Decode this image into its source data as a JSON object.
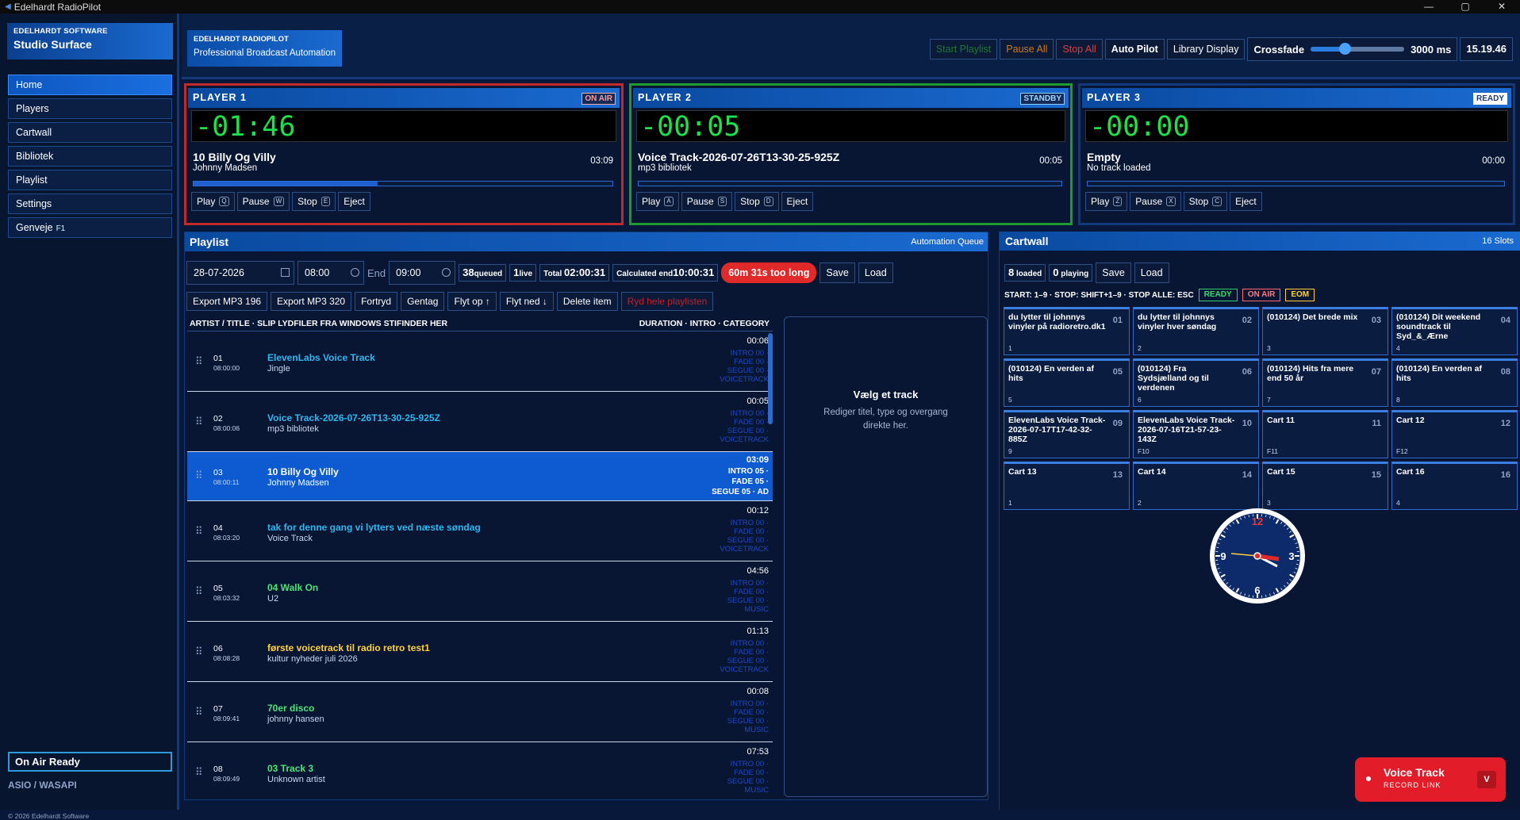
{
  "window": {
    "title": "Edelhardt RadioPilot",
    "controls": [
      "—",
      "▢",
      "✕"
    ]
  },
  "sidebar": {
    "brand_line1": "EDELHARDT SOFTWARE",
    "brand_line2": "Studio Surface",
    "items": [
      {
        "label": "Home",
        "active": true
      },
      {
        "label": "Players"
      },
      {
        "label": "Cartwall"
      },
      {
        "label": "Bibliotek"
      },
      {
        "label": "Playlist"
      },
      {
        "label": "Settings"
      },
      {
        "label": "Genveje",
        "key": "F1"
      }
    ],
    "on_air_ready": "On Air Ready",
    "audio_api": "ASIO / WASAPI",
    "copyright": "© 2026 Edelhardt Software"
  },
  "topbar": {
    "brand_line1": "EDELHARDT RADIOPILOT",
    "brand_line2": "Professional Broadcast Automation",
    "start_playlist": "Start Playlist",
    "pause_all": "Pause All",
    "stop_all": "Stop All",
    "auto_pilot": "Auto Pilot",
    "library_display": "Library Display",
    "crossfade_label": "Crossfade",
    "crossfade_value": "3000 ms",
    "crossfade_level": 0.36,
    "clock": "15.19.46"
  },
  "players": [
    {
      "name": "PLAYER 1",
      "status": "ON AIR",
      "timer": "-01:46",
      "title": "10 Billy Og Villy",
      "artist": "Johnny Madsen",
      "duration": "03:09",
      "progress": 0.44,
      "buttons": [
        {
          "label": "Play",
          "key": "Q"
        },
        {
          "label": "Pause",
          "key": "W"
        },
        {
          "label": "Stop",
          "key": "E"
        },
        {
          "label": "Eject"
        }
      ]
    },
    {
      "name": "PLAYER 2",
      "status": "STANDBY",
      "timer": "-00:05",
      "title": "Voice Track-2026-07-26T13-30-25-925Z",
      "artist": "mp3 bibliotek",
      "duration": "00:05",
      "progress": 0,
      "buttons": [
        {
          "label": "Play",
          "key": "A"
        },
        {
          "label": "Pause",
          "key": "S"
        },
        {
          "label": "Stop",
          "key": "D"
        },
        {
          "label": "Eject"
        }
      ]
    },
    {
      "name": "PLAYER 3",
      "status": "READY",
      "timer": "-00:00",
      "title": "Empty",
      "artist": "No track loaded",
      "duration": "00:00",
      "progress": 0,
      "buttons": [
        {
          "label": "Play",
          "key": "Z"
        },
        {
          "label": "Pause",
          "key": "X"
        },
        {
          "label": "Stop",
          "key": "C"
        },
        {
          "label": "Eject"
        }
      ]
    }
  ],
  "playlist": {
    "title": "Playlist",
    "subtitle": "Automation Queue",
    "date": "28-07-2026",
    "start_time": "08:00",
    "end_label": "End",
    "end_time": "09:00",
    "queued_num": "38",
    "queued_label": "queued",
    "live_num": "1",
    "live_label": "live",
    "total_label": "Total",
    "total_value": "02:00:31",
    "calc_label": "Calculated end",
    "calc_value": "10:00:31",
    "too_long": "60m 31s too long",
    "save": "Save",
    "load": "Load",
    "tools": [
      "Export MP3 196",
      "Export MP3 320",
      "Fortryd",
      "Gentag",
      "Flyt op ↑",
      "Flyt ned ↓",
      "Delete item",
      "Ryd hele playlisten"
    ],
    "col_left": "ARTIST / TITLE · SLIP LYDFILER FRA WINDOWS STIFINDER HER",
    "col_right": "DURATION · INTRO · CATEGORY",
    "rows": [
      {
        "num": "01",
        "start": "08:00:00",
        "title": "ElevenLabs Voice Track",
        "artist": "Jingle",
        "duration": "00:06",
        "color": "#2fb7f0",
        "meta": [
          "INTRO 00 ·",
          "FADE 00 ·",
          "SEGUE 00 ·",
          "VOICETRACK"
        ]
      },
      {
        "num": "02",
        "start": "08:00:06",
        "title": "Voice Track-2026-07-26T13-30-25-925Z",
        "artist": "mp3 bibliotek",
        "duration": "00:05",
        "color": "#2fb7f0",
        "meta": [
          "INTRO 00 ·",
          "FADE 00 ·",
          "SEGUE 00 ·",
          "VOICETRACK"
        ]
      },
      {
        "num": "03",
        "start": "08:00:11",
        "title": "10 Billy Og Villy",
        "artist": "Johnny Madsen",
        "duration": "03:09",
        "color": "#ffffff",
        "selected": true,
        "meta": [
          "INTRO 05 ·",
          "FADE 05 ·",
          "SEGUE 05 · AD"
        ]
      },
      {
        "num": "04",
        "start": "08:03:20",
        "title": "tak for denne gang vi lytters ved næste søndag",
        "artist": "Voice Track",
        "duration": "00:12",
        "color": "#2fb7f0",
        "meta": [
          "INTRO 00 ·",
          "FADE 00 ·",
          "SEGUE 00 ·",
          "VOICETRACK"
        ]
      },
      {
        "num": "05",
        "start": "08:03:32",
        "title": "04 Walk On",
        "artist": "U2",
        "duration": "04:56",
        "color": "#4de37a",
        "meta": [
          "INTRO 00 ·",
          "FADE 00 ·",
          "SEGUE 00 ·",
          "MUSIC"
        ]
      },
      {
        "num": "06",
        "start": "08:08:28",
        "title": "første voicetrack til radio retro test1",
        "artist": "kultur nyheder juli 2026",
        "duration": "01:13",
        "color": "#ffd23c",
        "meta": [
          "INTRO 00 ·",
          "FADE 00 ·",
          "SEGUE 00 ·",
          "VOICETRACK"
        ]
      },
      {
        "num": "07",
        "start": "08:09:41",
        "title": "70er disco",
        "artist": "johnny hansen",
        "duration": "00:08",
        "color": "#4de37a",
        "meta": [
          "INTRO 00 ·",
          "FADE 00 ·",
          "SEGUE 00 ·",
          "MUSIC"
        ]
      },
      {
        "num": "08",
        "start": "08:09:49",
        "title": "03 Track 3",
        "artist": "Unknown artist",
        "duration": "07:53",
        "color": "#4de37a",
        "meta": [
          "INTRO 00 ·",
          "FADE 00 ·",
          "SEGUE 00 ·",
          "MUSIC"
        ]
      }
    ],
    "editor_title": "Vælg et track",
    "editor_sub": "Rediger titel, type og overgang direkte her."
  },
  "cartwall": {
    "title": "Cartwall",
    "slots": "16 Slots",
    "loaded_num": "8",
    "loaded_label": "loaded",
    "playing_num": "0",
    "playing_label": "playing",
    "save": "Save",
    "load": "Load",
    "keys_hint": "START: 1–9 · STOP: SHIFT+1–9 · STOP ALLE: ESC",
    "legend_ready": "READY",
    "legend_onair": "ON AIR",
    "legend_eom": "EOM",
    "carts": [
      {
        "title": "du lytter til johnnys vinyler på radioretro.dk1",
        "num": "01",
        "key": "1"
      },
      {
        "title": "du lytter til johnnys vinyler hver søndag",
        "num": "02",
        "key": "2"
      },
      {
        "title": "(010124) Det brede mix",
        "num": "03",
        "key": "3"
      },
      {
        "title": "(010124) Dit weekend soundtrack til Syd_&_Ærne",
        "num": "04",
        "key": "4"
      },
      {
        "title": "(010124) En verden af hits",
        "num": "05",
        "key": "5"
      },
      {
        "title": "(010124) Fra Sydsjælland og til verdenen",
        "num": "06",
        "key": "6"
      },
      {
        "title": "(010124) Hits fra mere end 50 år",
        "num": "07",
        "key": "7"
      },
      {
        "title": "(010124) En verden af hits",
        "num": "08",
        "key": "8"
      },
      {
        "title": "ElevenLabs Voice Track-2026-07-17T17-42-32-885Z",
        "num": "09",
        "key": "9"
      },
      {
        "title": "ElevenLabs Voice Track-2026-07-16T21-57-23-143Z",
        "num": "10",
        "key": "F10"
      },
      {
        "title": "Cart 11",
        "num": "11",
        "key": "F11"
      },
      {
        "title": "Cart 12",
        "num": "12",
        "key": "F12"
      },
      {
        "title": "Cart 13",
        "num": "13",
        "key": "1"
      },
      {
        "title": "Cart 14",
        "num": "14",
        "key": "2"
      },
      {
        "title": "Cart 15",
        "num": "15",
        "key": "3"
      },
      {
        "title": "Cart 16",
        "num": "16",
        "key": "4"
      }
    ],
    "clock_numerals": [
      "12",
      "3",
      "6",
      "9"
    ]
  },
  "voice_track": {
    "title": "Voice Track",
    "subtitle": "RECORD LINK",
    "key": "V"
  }
}
